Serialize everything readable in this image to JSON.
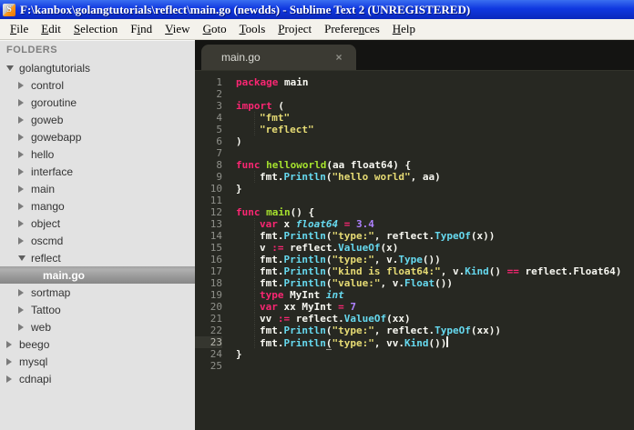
{
  "window": {
    "title": "F:\\kanbox\\golangtutorials\\reflect\\main.go (newdds) - Sublime Text 2 (UNREGISTERED)",
    "app_icon_glyph": "S"
  },
  "menu": {
    "items": [
      {
        "label": "File",
        "underline_index": 0
      },
      {
        "label": "Edit",
        "underline_index": 0
      },
      {
        "label": "Selection",
        "underline_index": 0
      },
      {
        "label": "Find",
        "underline_index": 1
      },
      {
        "label": "View",
        "underline_index": 0
      },
      {
        "label": "Goto",
        "underline_index": 0
      },
      {
        "label": "Tools",
        "underline_index": 0
      },
      {
        "label": "Project",
        "underline_index": 0
      },
      {
        "label": "Preferences",
        "underline_index": 7
      },
      {
        "label": "Help",
        "underline_index": 0
      }
    ]
  },
  "sidebar": {
    "header": "FOLDERS",
    "items": [
      {
        "label": "golangtutorials",
        "depth": 0,
        "state": "expanded",
        "selected": false
      },
      {
        "label": "control",
        "depth": 1,
        "state": "collapsed",
        "selected": false
      },
      {
        "label": "goroutine",
        "depth": 1,
        "state": "collapsed",
        "selected": false
      },
      {
        "label": "goweb",
        "depth": 1,
        "state": "collapsed",
        "selected": false
      },
      {
        "label": "gowebapp",
        "depth": 1,
        "state": "collapsed",
        "selected": false
      },
      {
        "label": "hello",
        "depth": 1,
        "state": "collapsed",
        "selected": false
      },
      {
        "label": "interface",
        "depth": 1,
        "state": "collapsed",
        "selected": false
      },
      {
        "label": "main",
        "depth": 1,
        "state": "collapsed",
        "selected": false
      },
      {
        "label": "mango",
        "depth": 1,
        "state": "collapsed",
        "selected": false
      },
      {
        "label": "object",
        "depth": 1,
        "state": "collapsed",
        "selected": false
      },
      {
        "label": "oscmd",
        "depth": 1,
        "state": "collapsed",
        "selected": false
      },
      {
        "label": "reflect",
        "depth": 1,
        "state": "expanded",
        "selected": false
      },
      {
        "label": "main.go",
        "depth": 2,
        "state": "file",
        "selected": true
      },
      {
        "label": "sortmap",
        "depth": 1,
        "state": "collapsed",
        "selected": false
      },
      {
        "label": "Tattoo",
        "depth": 1,
        "state": "collapsed",
        "selected": false
      },
      {
        "label": "web",
        "depth": 1,
        "state": "collapsed",
        "selected": false
      },
      {
        "label": "beego",
        "depth": 0,
        "state": "collapsed",
        "selected": false
      },
      {
        "label": "mysql",
        "depth": 0,
        "state": "collapsed",
        "selected": false
      },
      {
        "label": "cdnapi",
        "depth": 0,
        "state": "collapsed",
        "selected": false
      }
    ]
  },
  "editor": {
    "tab": {
      "label": "main.go",
      "close": "×"
    },
    "lines": [
      {
        "n": 1,
        "ind": 0,
        "tk": [
          [
            "k",
            "package"
          ],
          [
            "p",
            " main"
          ]
        ]
      },
      {
        "n": 2,
        "ind": 0,
        "tk": []
      },
      {
        "n": 3,
        "ind": 0,
        "tk": [
          [
            "k",
            "import"
          ],
          [
            "p",
            " ("
          ]
        ]
      },
      {
        "n": 4,
        "ind": 1,
        "tk": [
          [
            "s",
            "\"fmt\""
          ]
        ]
      },
      {
        "n": 5,
        "ind": 1,
        "tk": [
          [
            "s",
            "\"reflect\""
          ]
        ]
      },
      {
        "n": 6,
        "ind": 0,
        "tk": [
          [
            "p",
            ")"
          ]
        ]
      },
      {
        "n": 7,
        "ind": 0,
        "tk": []
      },
      {
        "n": 8,
        "ind": 0,
        "tk": [
          [
            "k",
            "func"
          ],
          [
            "p",
            " "
          ],
          [
            "f",
            "helloworld"
          ],
          [
            "p",
            "(aa float64) {"
          ]
        ]
      },
      {
        "n": 9,
        "ind": 1,
        "tk": [
          [
            "p",
            "fmt."
          ],
          [
            "c",
            "Println"
          ],
          [
            "p",
            "("
          ],
          [
            "s",
            "\"hello world\""
          ],
          [
            "p",
            ", aa)"
          ]
        ]
      },
      {
        "n": 10,
        "ind": 0,
        "tk": [
          [
            "p",
            "}"
          ]
        ]
      },
      {
        "n": 11,
        "ind": 0,
        "tk": []
      },
      {
        "n": 12,
        "ind": 0,
        "tk": [
          [
            "k",
            "func"
          ],
          [
            "p",
            " "
          ],
          [
            "f",
            "main"
          ],
          [
            "p",
            "() {"
          ]
        ]
      },
      {
        "n": 13,
        "ind": 1,
        "tk": [
          [
            "k",
            "var"
          ],
          [
            "p",
            " x "
          ],
          [
            "t",
            "float64"
          ],
          [
            "p",
            " "
          ],
          [
            "k",
            "="
          ],
          [
            "p",
            " "
          ],
          [
            "n",
            "3.4"
          ]
        ]
      },
      {
        "n": 14,
        "ind": 1,
        "tk": [
          [
            "p",
            "fmt."
          ],
          [
            "c",
            "Println"
          ],
          [
            "p",
            "("
          ],
          [
            "s",
            "\"type:\""
          ],
          [
            "p",
            ", reflect."
          ],
          [
            "c",
            "TypeOf"
          ],
          [
            "p",
            "(x))"
          ]
        ]
      },
      {
        "n": 15,
        "ind": 1,
        "tk": [
          [
            "p",
            "v "
          ],
          [
            "k",
            ":="
          ],
          [
            "p",
            " reflect."
          ],
          [
            "c",
            "ValueOf"
          ],
          [
            "p",
            "(x)"
          ]
        ]
      },
      {
        "n": 16,
        "ind": 1,
        "tk": [
          [
            "p",
            "fmt."
          ],
          [
            "c",
            "Println"
          ],
          [
            "p",
            "("
          ],
          [
            "s",
            "\"type:\""
          ],
          [
            "p",
            ", v."
          ],
          [
            "c",
            "Type"
          ],
          [
            "p",
            "())"
          ]
        ]
      },
      {
        "n": 17,
        "ind": 1,
        "tk": [
          [
            "p",
            "fmt."
          ],
          [
            "c",
            "Println"
          ],
          [
            "p",
            "("
          ],
          [
            "s",
            "\"kind is float64:\""
          ],
          [
            "p",
            ", v."
          ],
          [
            "c",
            "Kind"
          ],
          [
            "p",
            "() "
          ],
          [
            "k",
            "=="
          ],
          [
            "p",
            " reflect.Float64)"
          ]
        ]
      },
      {
        "n": 18,
        "ind": 1,
        "tk": [
          [
            "p",
            "fmt."
          ],
          [
            "c",
            "Println"
          ],
          [
            "p",
            "("
          ],
          [
            "s",
            "\"value:\""
          ],
          [
            "p",
            ", v."
          ],
          [
            "c",
            "Float"
          ],
          [
            "p",
            "())"
          ]
        ]
      },
      {
        "n": 19,
        "ind": 1,
        "tk": [
          [
            "k",
            "type"
          ],
          [
            "p",
            " MyInt "
          ],
          [
            "t",
            "int"
          ]
        ]
      },
      {
        "n": 20,
        "ind": 1,
        "tk": [
          [
            "k",
            "var"
          ],
          [
            "p",
            " xx MyInt "
          ],
          [
            "k",
            "="
          ],
          [
            "p",
            " "
          ],
          [
            "n",
            "7"
          ]
        ]
      },
      {
        "n": 21,
        "ind": 1,
        "tk": [
          [
            "p",
            "vv "
          ],
          [
            "k",
            ":="
          ],
          [
            "p",
            " reflect."
          ],
          [
            "c",
            "ValueOf"
          ],
          [
            "p",
            "(xx)"
          ]
        ]
      },
      {
        "n": 22,
        "ind": 1,
        "tk": [
          [
            "p",
            "fmt."
          ],
          [
            "c",
            "Println"
          ],
          [
            "p",
            "("
          ],
          [
            "s",
            "\"type:\""
          ],
          [
            "p",
            ", reflect."
          ],
          [
            "c",
            "TypeOf"
          ],
          [
            "p",
            "(xx))"
          ]
        ]
      },
      {
        "n": 23,
        "ind": 1,
        "tk": [
          [
            "p",
            "fmt."
          ],
          [
            "c",
            "Println"
          ],
          [
            "pu",
            "("
          ],
          [
            "s",
            "\"type:\""
          ],
          [
            "p",
            ", vv."
          ],
          [
            "c",
            "Kind"
          ],
          [
            "p",
            "())"
          ]
        ],
        "current": true,
        "cursor": true
      },
      {
        "n": 24,
        "ind": 0,
        "tk": [
          [
            "p",
            "}"
          ]
        ]
      },
      {
        "n": 25,
        "ind": 0,
        "tk": []
      }
    ]
  },
  "theme": {
    "titlebar_blue": "#1038e0",
    "titlebar_blue_light": "#3a6ff0",
    "titlebar_blue_dark": "#0a28bc",
    "menubar_bg": "#f4f2ec",
    "sidebar_bg": "#e2e2e2",
    "sidebar_text": "#333333",
    "selection_light": "#b0b0b0",
    "selection_dark": "#878787",
    "tabbar_bg": "#141412",
    "tab_bg": "#3b3a33",
    "editor_bg": "#272822",
    "text": "#f8f8f2",
    "keyword": "#f92672",
    "string": "#e6db74",
    "function_name": "#a6e22e",
    "call": "#66d9ef",
    "type_italic": "#66d9ef",
    "number": "#ae81ff",
    "line_number": "#8f908a"
  }
}
